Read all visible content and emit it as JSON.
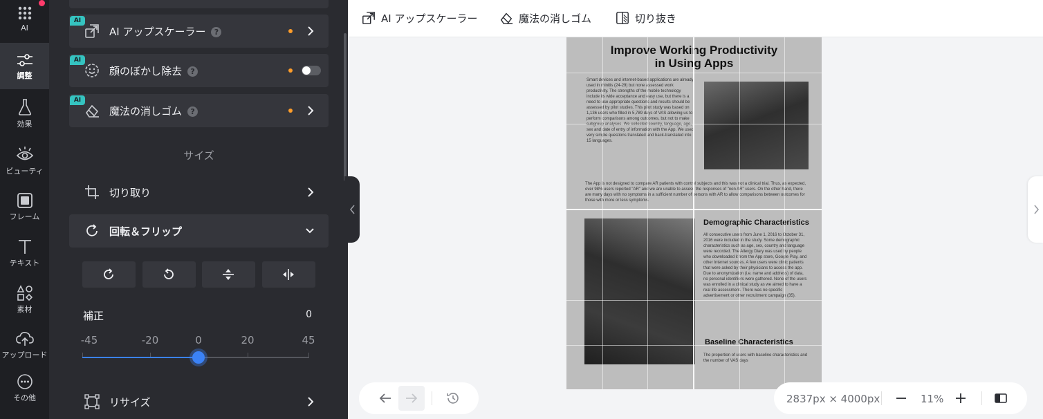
{
  "rail": {
    "items": [
      {
        "label": "AI",
        "icon": "ai-grid-icon"
      },
      {
        "label": "調整",
        "icon": "sliders-icon"
      },
      {
        "label": "効果",
        "icon": "flask-icon"
      },
      {
        "label": "ビューティ",
        "icon": "eye-icon"
      },
      {
        "label": "フレーム",
        "icon": "frame-icon"
      },
      {
        "label": "テキスト",
        "icon": "text-icon"
      },
      {
        "label": "素材",
        "icon": "shapes-icon"
      },
      {
        "label": "アップロード",
        "icon": "upload-cloud-icon"
      },
      {
        "label": "その他",
        "icon": "more-icon"
      }
    ],
    "active": "調整",
    "notification_color": "#ff3b6b"
  },
  "panel": {
    "ai_badge": "AI",
    "ai_rows": [
      {
        "label": "AI アップスケーラー",
        "help": "?",
        "control": "chevron"
      },
      {
        "label": "顔のぼかし除去",
        "help": "?",
        "control": "toggle"
      },
      {
        "label": "魔法の消しゴム",
        "help": "?",
        "control": "chevron"
      }
    ],
    "size_section": "サイズ",
    "crop_label": "切り取り",
    "rotate_flip_label": "回転＆フリップ",
    "rotate_buttons": [
      "rotate-cw-icon",
      "rotate-ccw-icon",
      "flip-vertical-icon",
      "flip-horizontal-icon"
    ],
    "correction": {
      "label": "補正",
      "value": "0",
      "ticks": [
        "-45",
        "-20",
        "0",
        "20",
        "45"
      ],
      "min": -45,
      "max": 45,
      "current": 0
    },
    "resize_label": "リサイズ"
  },
  "toolbar": {
    "upscaler": "AI アップスケーラー",
    "eraser": "魔法の消しゴム",
    "cutout": "切り抜き"
  },
  "document": {
    "title_line1": "Improve Working Productivity",
    "title_line2": "in Using Apps",
    "para1": "Smart devices and internet-based applications are already used in rhinitis (24-29) but none assessed work productivity. The strengths of the mobile technology include its wide acceptance and easy use, but there is a need to use appropriate questions and results should be assessed by pilot studies. This pilot study was based on 1,136 users who filled in 5,789 days of VAS allowing us to perform comparisons among outcomes, but not to make subgroup analyses. We collected country, language, age, sex and date of entry of information with the App. We used very simple questions translated and back-translated into 15 languages.",
    "para2": "The App is not designed to compare AR patients with control subjects and this was not a clinical trial. Thus, as expected, over 98% users reported \"AR\" and we are unable to assess the responses of \"non AR\" users. On the other hand, there are many days with no symptoms in a sufficient number of persons with AR to allow comparisons between outcomes for those with more or less symptoms.",
    "heading_demographic": "Demographic Characteristics",
    "para3": "All consecutive users from June 1, 2016 to October 31, 2016 were included in the study. Some demographic characteristics such as age, sex, country and language were recorded. The Allergy Diary was used by people who downloaded it from the App store, Google Play, and other Internet sources. A few users were clinic patients that were asked by their physicians to access the app. Due to anonymization (i.e. name and address) of data, no personal identifiers were gathered. None of the users was enrolled in a clinical study as we aimed to have a real life assessment. There was no specific advertisement or other recruitment campaign (35).",
    "heading_baseline": "Baseline Characteristics",
    "para4": "The proportion of users with baseline characteristics and the number of VAS days"
  },
  "status": {
    "dimensions": "2837px × 4000px",
    "zoom": "11%",
    "zoom_out": "−",
    "zoom_in": "+"
  },
  "colors": {
    "accent": "#3b82f6",
    "ai_badge": "#35c3c0",
    "new_dot": "#ff9d2a",
    "panel_bg": "#2a2b30",
    "rail_bg": "#1e1f23"
  }
}
